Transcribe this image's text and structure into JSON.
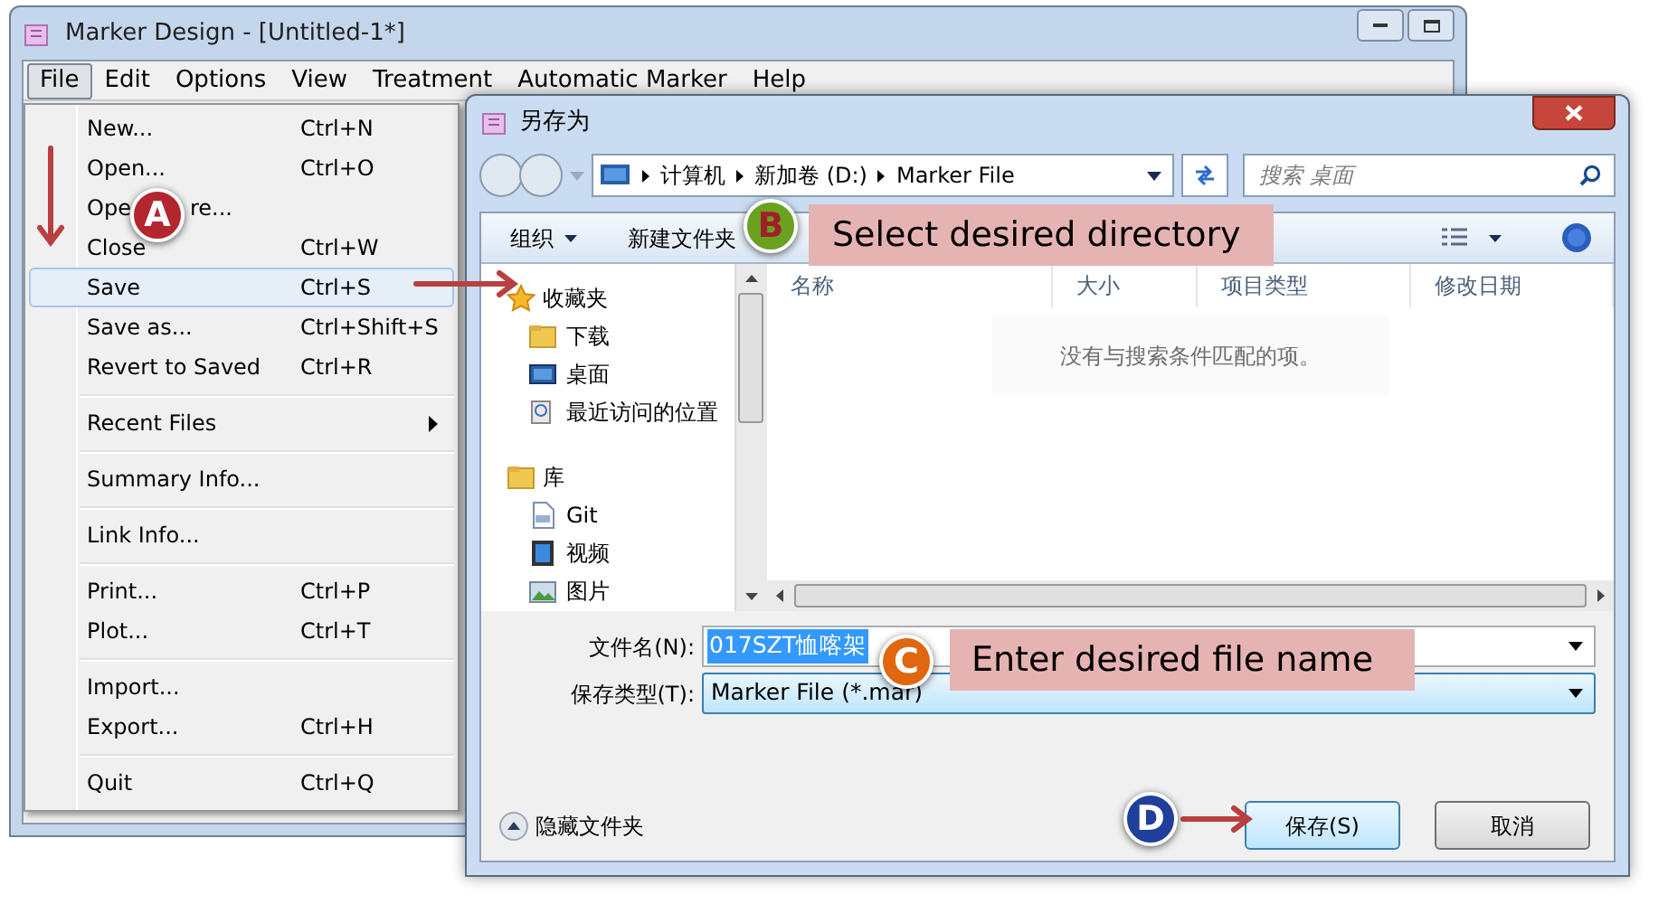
{
  "main_window": {
    "title": "Marker Design - [Untitled-1*]"
  },
  "menu_bar": [
    {
      "label": "File",
      "selected": true
    },
    {
      "label": "Edit",
      "selected": false
    },
    {
      "label": "Options",
      "selected": false
    },
    {
      "label": "View",
      "selected": false
    },
    {
      "label": "Treatment",
      "selected": false
    },
    {
      "label": "Automatic Marker",
      "selected": false
    },
    {
      "label": "Help",
      "selected": false
    }
  ],
  "file_menu": [
    {
      "kind": "item",
      "label": "New...",
      "shortcut": "Ctrl+N",
      "selected": false
    },
    {
      "kind": "item",
      "label": "Open...",
      "shortcut": "Ctrl+O",
      "selected": false
    },
    {
      "kind": "split",
      "label": "Ope",
      "label_tail": "re..."
    },
    {
      "kind": "item",
      "label": "Close",
      "shortcut": "Ctrl+W",
      "selected": false
    },
    {
      "kind": "item",
      "label": "Save",
      "shortcut": "Ctrl+S",
      "selected": true
    },
    {
      "kind": "item",
      "label": "Save as...",
      "shortcut": "Ctrl+Shift+S",
      "selected": false
    },
    {
      "kind": "item",
      "label": "Revert to Saved",
      "shortcut": "Ctrl+R",
      "selected": false
    },
    {
      "kind": "separator"
    },
    {
      "kind": "submenu",
      "label": "Recent Files",
      "selected": false
    },
    {
      "kind": "separator"
    },
    {
      "kind": "item",
      "label": "Summary Info...",
      "selected": false
    },
    {
      "kind": "separator"
    },
    {
      "kind": "item",
      "label": "Link Info...",
      "selected": false
    },
    {
      "kind": "separator"
    },
    {
      "kind": "item",
      "label": "Print...",
      "shortcut": "Ctrl+P",
      "selected": false
    },
    {
      "kind": "item",
      "label": "Plot...",
      "shortcut": "Ctrl+T",
      "selected": false
    },
    {
      "kind": "separator"
    },
    {
      "kind": "item",
      "label": "Import...",
      "selected": false
    },
    {
      "kind": "item",
      "label": "Export...",
      "shortcut": "Ctrl+H",
      "selected": false
    },
    {
      "kind": "separator"
    },
    {
      "kind": "item",
      "label": "Quit",
      "shortcut": "Ctrl+Q",
      "selected": false
    }
  ],
  "dialog": {
    "title": "另存为",
    "breadcrumb": [
      "计算机",
      "新加卷 (D:)",
      "Marker File"
    ],
    "search": {
      "placeholder": "搜索 桌面"
    },
    "toolbar": {
      "organize": "组织",
      "new_folder": "新建文件夹"
    },
    "nav_tree": [
      {
        "label": "收藏夹",
        "children": [
          {
            "label": "下载"
          },
          {
            "label": "桌面"
          },
          {
            "label": "最近访问的位置"
          }
        ]
      },
      {
        "label": "库",
        "children": [
          {
            "label": "Git"
          },
          {
            "label": "视频"
          },
          {
            "label": "图片"
          }
        ]
      }
    ],
    "columns": [
      "名称",
      "大小",
      "项目类型",
      "修改日期"
    ],
    "empty_message": "没有与搜索条件匹配的项。",
    "file_name": {
      "label": "文件名(N):",
      "value": "017SZT恤喀架"
    },
    "save_type": {
      "label": "保存类型(T):",
      "value": "Marker File (*.mar)"
    },
    "hide_folders": "隐藏文件夹",
    "buttons": [
      {
        "label": "保存(S)",
        "default": true
      },
      {
        "label": "取消",
        "default": false
      }
    ]
  },
  "callouts": [
    {
      "letter": "A",
      "color": "#b3262e"
    },
    {
      "letter": "B",
      "color": "#6aa121",
      "text": "Select desired directory"
    },
    {
      "letter": "C",
      "color": "#e0660f",
      "text": "Enter desired file name"
    },
    {
      "letter": "D",
      "color": "#1f3f9a"
    }
  ]
}
